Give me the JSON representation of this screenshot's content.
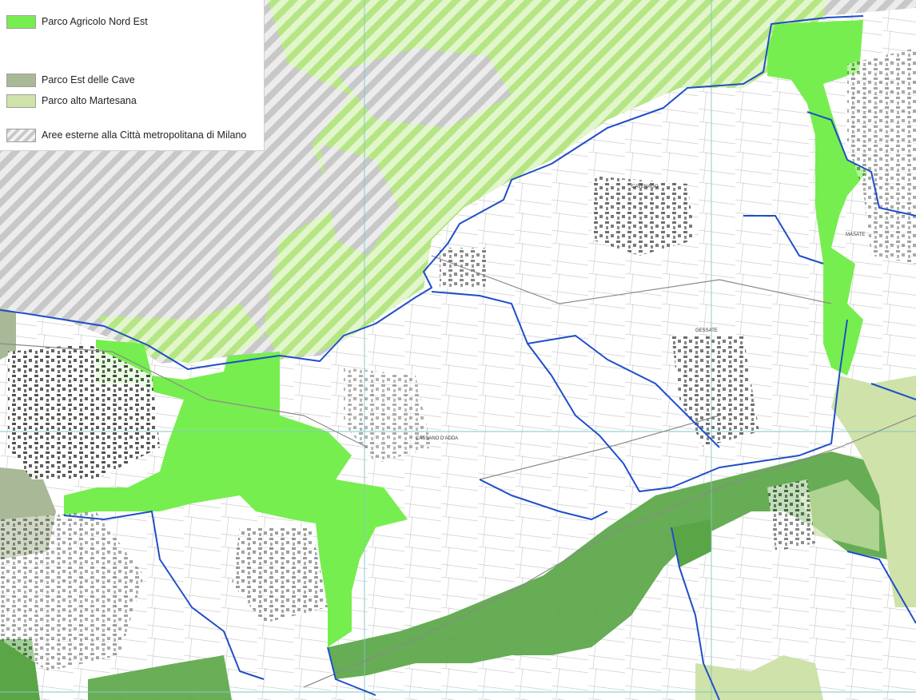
{
  "legend": {
    "items": [
      {
        "label": "Parco Agricolo Nord Est",
        "color": "#77ee4f",
        "pattern": "solid"
      },
      {
        "label": "Parco Est delle Cave",
        "color": "#a9b896",
        "pattern": "solid"
      },
      {
        "label": "Parco alto Martesana",
        "color": "#cfe2a9",
        "pattern": "solid"
      },
      {
        "label": "Aree esterne alla Città metropolitana di Milano",
        "color": "#d9d9d9",
        "pattern": "hatched"
      }
    ]
  },
  "map": {
    "colors": {
      "boundary": "#1f4fc7",
      "grid": "#7ec8c8",
      "park_green": "#77ee4f",
      "martesana_dark": "#5aa646",
      "martesana_light": "#cfe2a9",
      "cave": "#a9b896",
      "hatch": "#cfcfcf",
      "hatch_green": "#c9ef9c"
    },
    "place_labels": [
      {
        "text": "MASATE"
      },
      {
        "text": "CAVENAGO"
      },
      {
        "text": "GESSATE"
      },
      {
        "text": "CASSANO D'ADDA"
      }
    ]
  }
}
